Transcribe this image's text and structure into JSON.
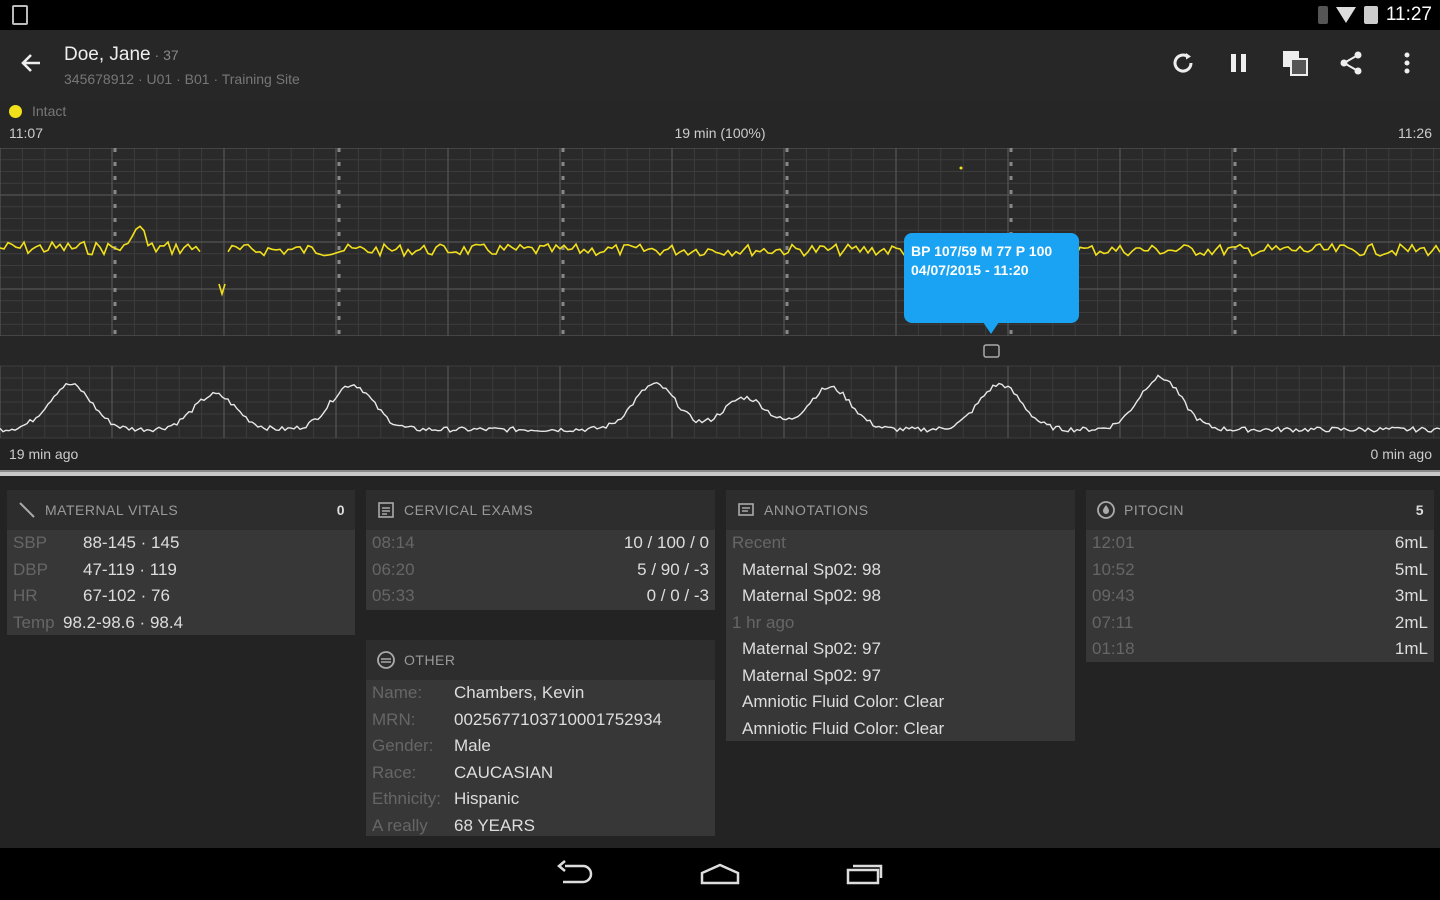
{
  "status_bar": {
    "time": "11:27"
  },
  "app_bar": {
    "name": "Doe, Jane",
    "age": " · 37",
    "subtitle": "345678912 · U01 · B01 · Training Site"
  },
  "legend": {
    "label": "Intact",
    "color": "#f2e01a"
  },
  "timeline": {
    "start": "11:07",
    "center": "19 min (100%)",
    "end": "11:26",
    "left_ago": "19 min ago",
    "right_ago": "0 min ago"
  },
  "tooltip": {
    "line1": "BP 107/59 M 77 P 100",
    "line2": "04/07/2015 - 11:20",
    "color": "#1aa3f2"
  },
  "vitals": {
    "title": "MATERNAL VITALS",
    "count": "0",
    "rows": [
      {
        "k": "SBP",
        "v": "88-145 · 145"
      },
      {
        "k": "DBP",
        "v": "47-119 · 119"
      },
      {
        "k": "HR",
        "v": "67-102 · 76"
      },
      {
        "k": "Temp",
        "v": "98.2-98.6 · 98.4"
      }
    ]
  },
  "cervical": {
    "title": "CERVICAL EXAMS",
    "rows": [
      {
        "t": "08:14",
        "v": "10 / 100 / 0"
      },
      {
        "t": "06:20",
        "v": "5 / 90 / -3"
      },
      {
        "t": "05:33",
        "v": "0 / 0 / -3"
      }
    ]
  },
  "other": {
    "title": "OTHER",
    "rows": [
      {
        "k": "Name:",
        "v": "Chambers, Kevin"
      },
      {
        "k": "MRN:",
        "v": "0025677103710001752934"
      },
      {
        "k": "Gender:",
        "v": "Male"
      },
      {
        "k": "Race:",
        "v": "CAUCASIAN"
      },
      {
        "k": "Ethnicity:",
        "v": "Hispanic"
      },
      {
        "k": "A really",
        "v": "68 YEARS"
      }
    ]
  },
  "annotations": {
    "title": "ANNOTATIONS",
    "rows": [
      {
        "sub": "Recent"
      },
      {
        "v": "Maternal Sp02: 98"
      },
      {
        "v": "Maternal Sp02: 98"
      },
      {
        "sub": "1 hr ago"
      },
      {
        "v": "Maternal Sp02: 97"
      },
      {
        "v": "Maternal Sp02: 97"
      },
      {
        "v": "Amniotic Fluid Color: Clear"
      },
      {
        "v": "Amniotic Fluid Color: Clear"
      }
    ]
  },
  "pitocin": {
    "title": "PITOCIN",
    "count": "5",
    "rows": [
      {
        "t": "12:01",
        "v": "6mL"
      },
      {
        "t": "10:52",
        "v": "5mL"
      },
      {
        "t": "09:43",
        "v": "3mL"
      },
      {
        "t": "07:11",
        "v": "2mL"
      },
      {
        "t": "01:18",
        "v": "1mL"
      }
    ]
  },
  "icons": {
    "back": "arrow-left-icon",
    "refresh": "refresh-icon",
    "pause": "pause-icon",
    "layers": "layers-icon",
    "share": "share-icon",
    "more": "more-vert-icon",
    "nav_back": "nav-back-icon",
    "nav_home": "nav-home-icon",
    "nav_recent": "nav-recent-icon"
  }
}
